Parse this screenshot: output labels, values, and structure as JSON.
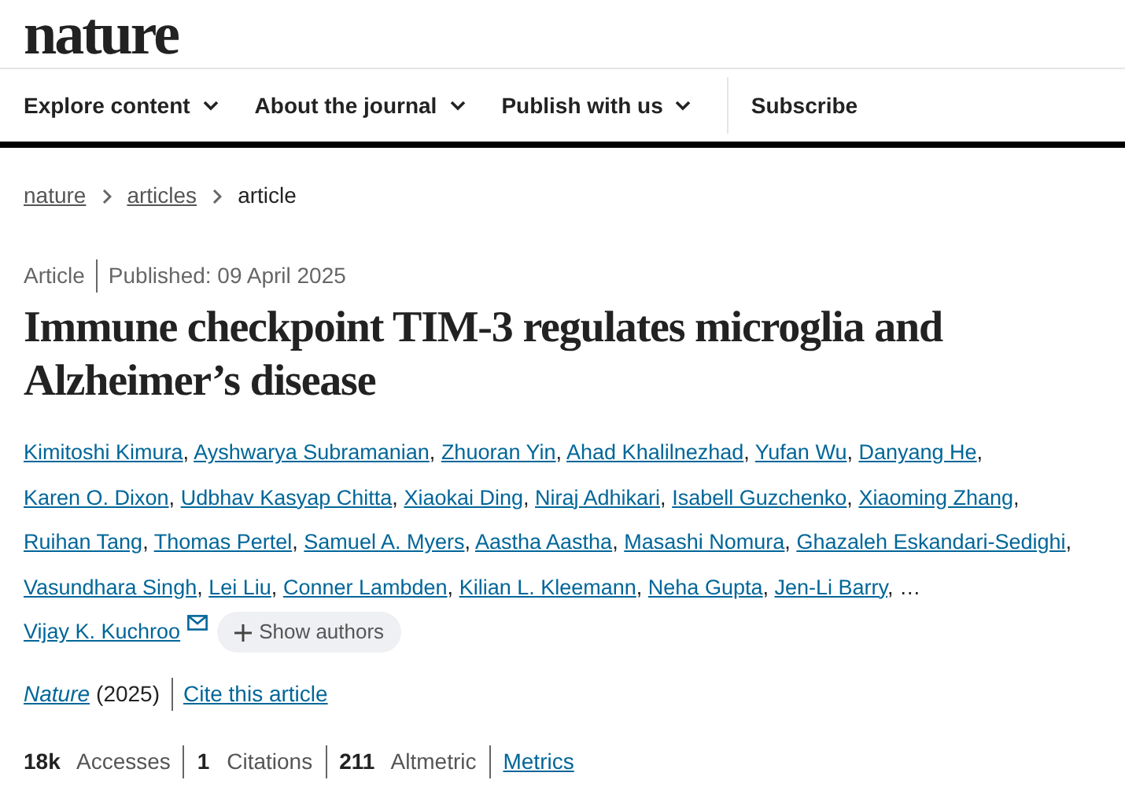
{
  "logo": "nature",
  "nav": {
    "items": [
      {
        "label": "Explore content",
        "kind": "dropdown"
      },
      {
        "label": "About the journal",
        "kind": "dropdown"
      },
      {
        "label": "Publish with us",
        "kind": "dropdown"
      },
      {
        "label": "Subscribe",
        "kind": "link"
      }
    ]
  },
  "breadcrumbs": [
    {
      "label": "nature",
      "kind": "link"
    },
    {
      "label": "articles",
      "kind": "link"
    },
    {
      "label": "article",
      "kind": "current"
    }
  ],
  "article": {
    "type": "Article",
    "published": "Published: 09 April 2025",
    "title": "Immune checkpoint TIM-3 regulates microglia and Alzheimer’s disease",
    "separator": ",",
    "authors": [
      {
        "name": "Kimitoshi Kimura",
        "kind": "author"
      },
      {
        "name": "Ayshwarya Subramanian",
        "kind": "author"
      },
      {
        "name": "Zhuoran Yin",
        "kind": "author"
      },
      {
        "name": "Ahad Khalilnezhad",
        "kind": "author"
      },
      {
        "name": "Yufan Wu",
        "kind": "author"
      },
      {
        "name": "Danyang He",
        "kind": "author"
      },
      {
        "name": "Karen O. Dixon",
        "kind": "author"
      },
      {
        "name": "Udbhav Kasyap Chitta",
        "kind": "author"
      },
      {
        "name": "Xiaokai Ding",
        "kind": "author"
      },
      {
        "name": "Niraj Adhikari",
        "kind": "author"
      },
      {
        "name": "Isabell Guzchenko",
        "kind": "author"
      },
      {
        "name": "Xiaoming Zhang",
        "kind": "author"
      },
      {
        "name": "Ruihan Tang",
        "kind": "author"
      },
      {
        "name": "Thomas Pertel",
        "kind": "author"
      },
      {
        "name": "Samuel A. Myers",
        "kind": "author"
      },
      {
        "name": "Aastha Aastha",
        "kind": "author"
      },
      {
        "name": "Masashi Nomura",
        "kind": "author"
      },
      {
        "name": "Ghazaleh Eskandari-Sedighi",
        "kind": "author"
      },
      {
        "name": "Vasundhara Singh",
        "kind": "author"
      },
      {
        "name": "Lei Liu",
        "kind": "author"
      },
      {
        "name": "Conner Lambden",
        "kind": "author"
      },
      {
        "name": "Kilian L. Kleemann",
        "kind": "author"
      },
      {
        "name": "Neha Gupta",
        "kind": "author"
      },
      {
        "name": "Jen-Li Barry",
        "kind": "author"
      },
      {
        "name": "…",
        "kind": "ellipsis"
      },
      {
        "name": "Vijay K. Kuchroo",
        "kind": "corresponding"
      }
    ],
    "show_authors": "Show authors",
    "journal": "Nature",
    "year": "(2025)",
    "cite": "Cite this article",
    "metrics": [
      {
        "count": "18k",
        "unit": "Accesses"
      },
      {
        "count": "1",
        "unit": "Citations"
      },
      {
        "count": "211",
        "unit": "Altmetric"
      }
    ],
    "metrics_link": "Metrics"
  }
}
